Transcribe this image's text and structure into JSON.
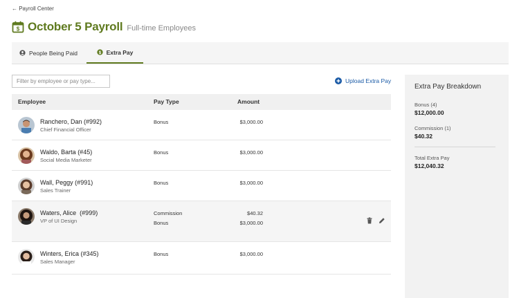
{
  "breadcrumb": "← Payroll Center",
  "header": {
    "title": "October 5 Payroll",
    "subtitle": "Full-time Employees",
    "accent": "#5f7a1f"
  },
  "tabs": [
    {
      "label": "People Being Paid",
      "icon": "person-icon"
    },
    {
      "label": "Extra Pay",
      "icon": "dollar-icon",
      "active": true
    }
  ],
  "filter": {
    "placeholder": "Filter by employee or pay type...",
    "value": ""
  },
  "upload_label": "Upload Extra Pay",
  "table": {
    "headers": {
      "employee": "Employee",
      "pay_type": "Pay Type",
      "amount": "Amount"
    },
    "rows": [
      {
        "name": "Ranchero, Dan (#992)",
        "title": "Chief Financial Officer",
        "pay": [
          {
            "type": "Bonus",
            "amount": "$3,000.00"
          }
        ]
      },
      {
        "name": "Waldo, Barta (#45)",
        "title": "Social Media Marketer",
        "pay": [
          {
            "type": "Bonus",
            "amount": "$3,000.00"
          }
        ]
      },
      {
        "name": "Wall, Peggy (#991)",
        "title": "Sales Trainer",
        "pay": [
          {
            "type": "Bonus",
            "amount": "$3,000.00"
          }
        ]
      },
      {
        "name": "Waters, Alice  (#999)",
        "title": "VP of UI Design",
        "pay": [
          {
            "type": "Commission",
            "amount": "$40.32"
          },
          {
            "type": "Bonus",
            "amount": "$3,000.00"
          }
        ],
        "hovered": true
      },
      {
        "name": "Winters, Erica (#345)",
        "title": "Sales Manager",
        "pay": [
          {
            "type": "Bonus",
            "amount": "$3,000.00"
          }
        ]
      }
    ]
  },
  "breakdown": {
    "title": "Extra Pay Breakdown",
    "items": [
      {
        "label": "Bonus (4)",
        "value": "$12,000.00"
      },
      {
        "label": "Commission (1)",
        "value": "$40.32"
      }
    ],
    "total": {
      "label": "Total Extra Pay",
      "value": "$12,040.32"
    }
  }
}
